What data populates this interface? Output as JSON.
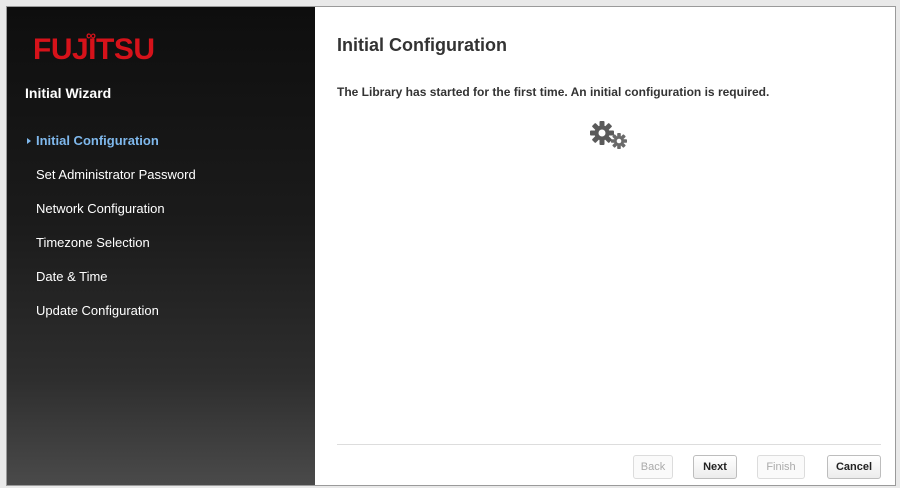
{
  "brand": {
    "logo_text": "FUJITSU",
    "logo_color": "#d6121a"
  },
  "sidebar": {
    "title": "Initial Wizard",
    "active_color": "#7fb8ec",
    "steps": [
      {
        "label": "Initial Configuration",
        "active": true
      },
      {
        "label": "Set Administrator Password",
        "active": false
      },
      {
        "label": "Network Configuration",
        "active": false
      },
      {
        "label": "Timezone Selection",
        "active": false
      },
      {
        "label": "Date & Time",
        "active": false
      },
      {
        "label": "Update Configuration",
        "active": false
      }
    ]
  },
  "main": {
    "title": "Initial Configuration",
    "message": "The Library has started for the first time. An initial configuration is required.",
    "status_icon": "gears-icon"
  },
  "buttons": {
    "back": {
      "label": "Back",
      "enabled": false
    },
    "next": {
      "label": "Next",
      "enabled": true
    },
    "finish": {
      "label": "Finish",
      "enabled": false
    },
    "cancel": {
      "label": "Cancel",
      "enabled": true
    }
  }
}
